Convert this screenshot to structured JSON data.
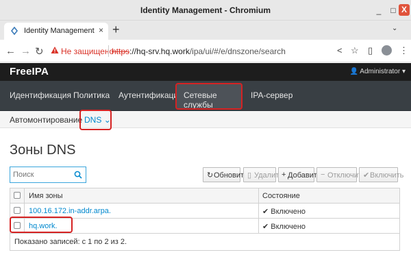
{
  "window": {
    "title": "Identity Management - Chromium",
    "controls": {
      "minimize": "_",
      "maximize": "□",
      "close": "X"
    }
  },
  "browser": {
    "tab_title": "Identity Management",
    "tab_close": "×",
    "new_tab": "+",
    "tab_dropdown": "⌄",
    "security_label": "Не защищено",
    "url_scheme": "https",
    "url_host": "://hq-srv.hq.work",
    "url_path": "/ipa/ui/#/e/dnszone/search"
  },
  "app": {
    "logo": "FreeIPA",
    "user_label": "Administrator",
    "main_nav": [
      "Идентификация",
      "Политика",
      "Аутентификация",
      "Сетевые службы",
      "IPA-сервер"
    ],
    "active_main_nav": "Сетевые службы",
    "sub_nav": [
      "Автомонтирование",
      "DNS"
    ],
    "active_sub_nav": "DNS"
  },
  "page": {
    "title": "Зоны DNS",
    "search": {
      "placeholder": "Поиск",
      "value": ""
    },
    "buttons": {
      "refresh": "Обновить",
      "delete": "Удалить",
      "add": "Добавить",
      "disable": "Отключить",
      "enable": "Включить"
    },
    "table": {
      "columns": [
        "Имя зоны",
        "Состояние"
      ],
      "rows": [
        {
          "name": "100.16.172.in-addr.arpa.",
          "status": "Включено"
        },
        {
          "name": "hq.work.",
          "status": "Включено"
        }
      ],
      "footer": "Показано записей: с 1 по 2 из 2."
    }
  },
  "colors": {
    "accent": "#0088ce",
    "nav_bg": "#393f44",
    "header_bg": "#1d1d1d",
    "highlight_outline": "#d62222",
    "insecure": "#d93025"
  }
}
